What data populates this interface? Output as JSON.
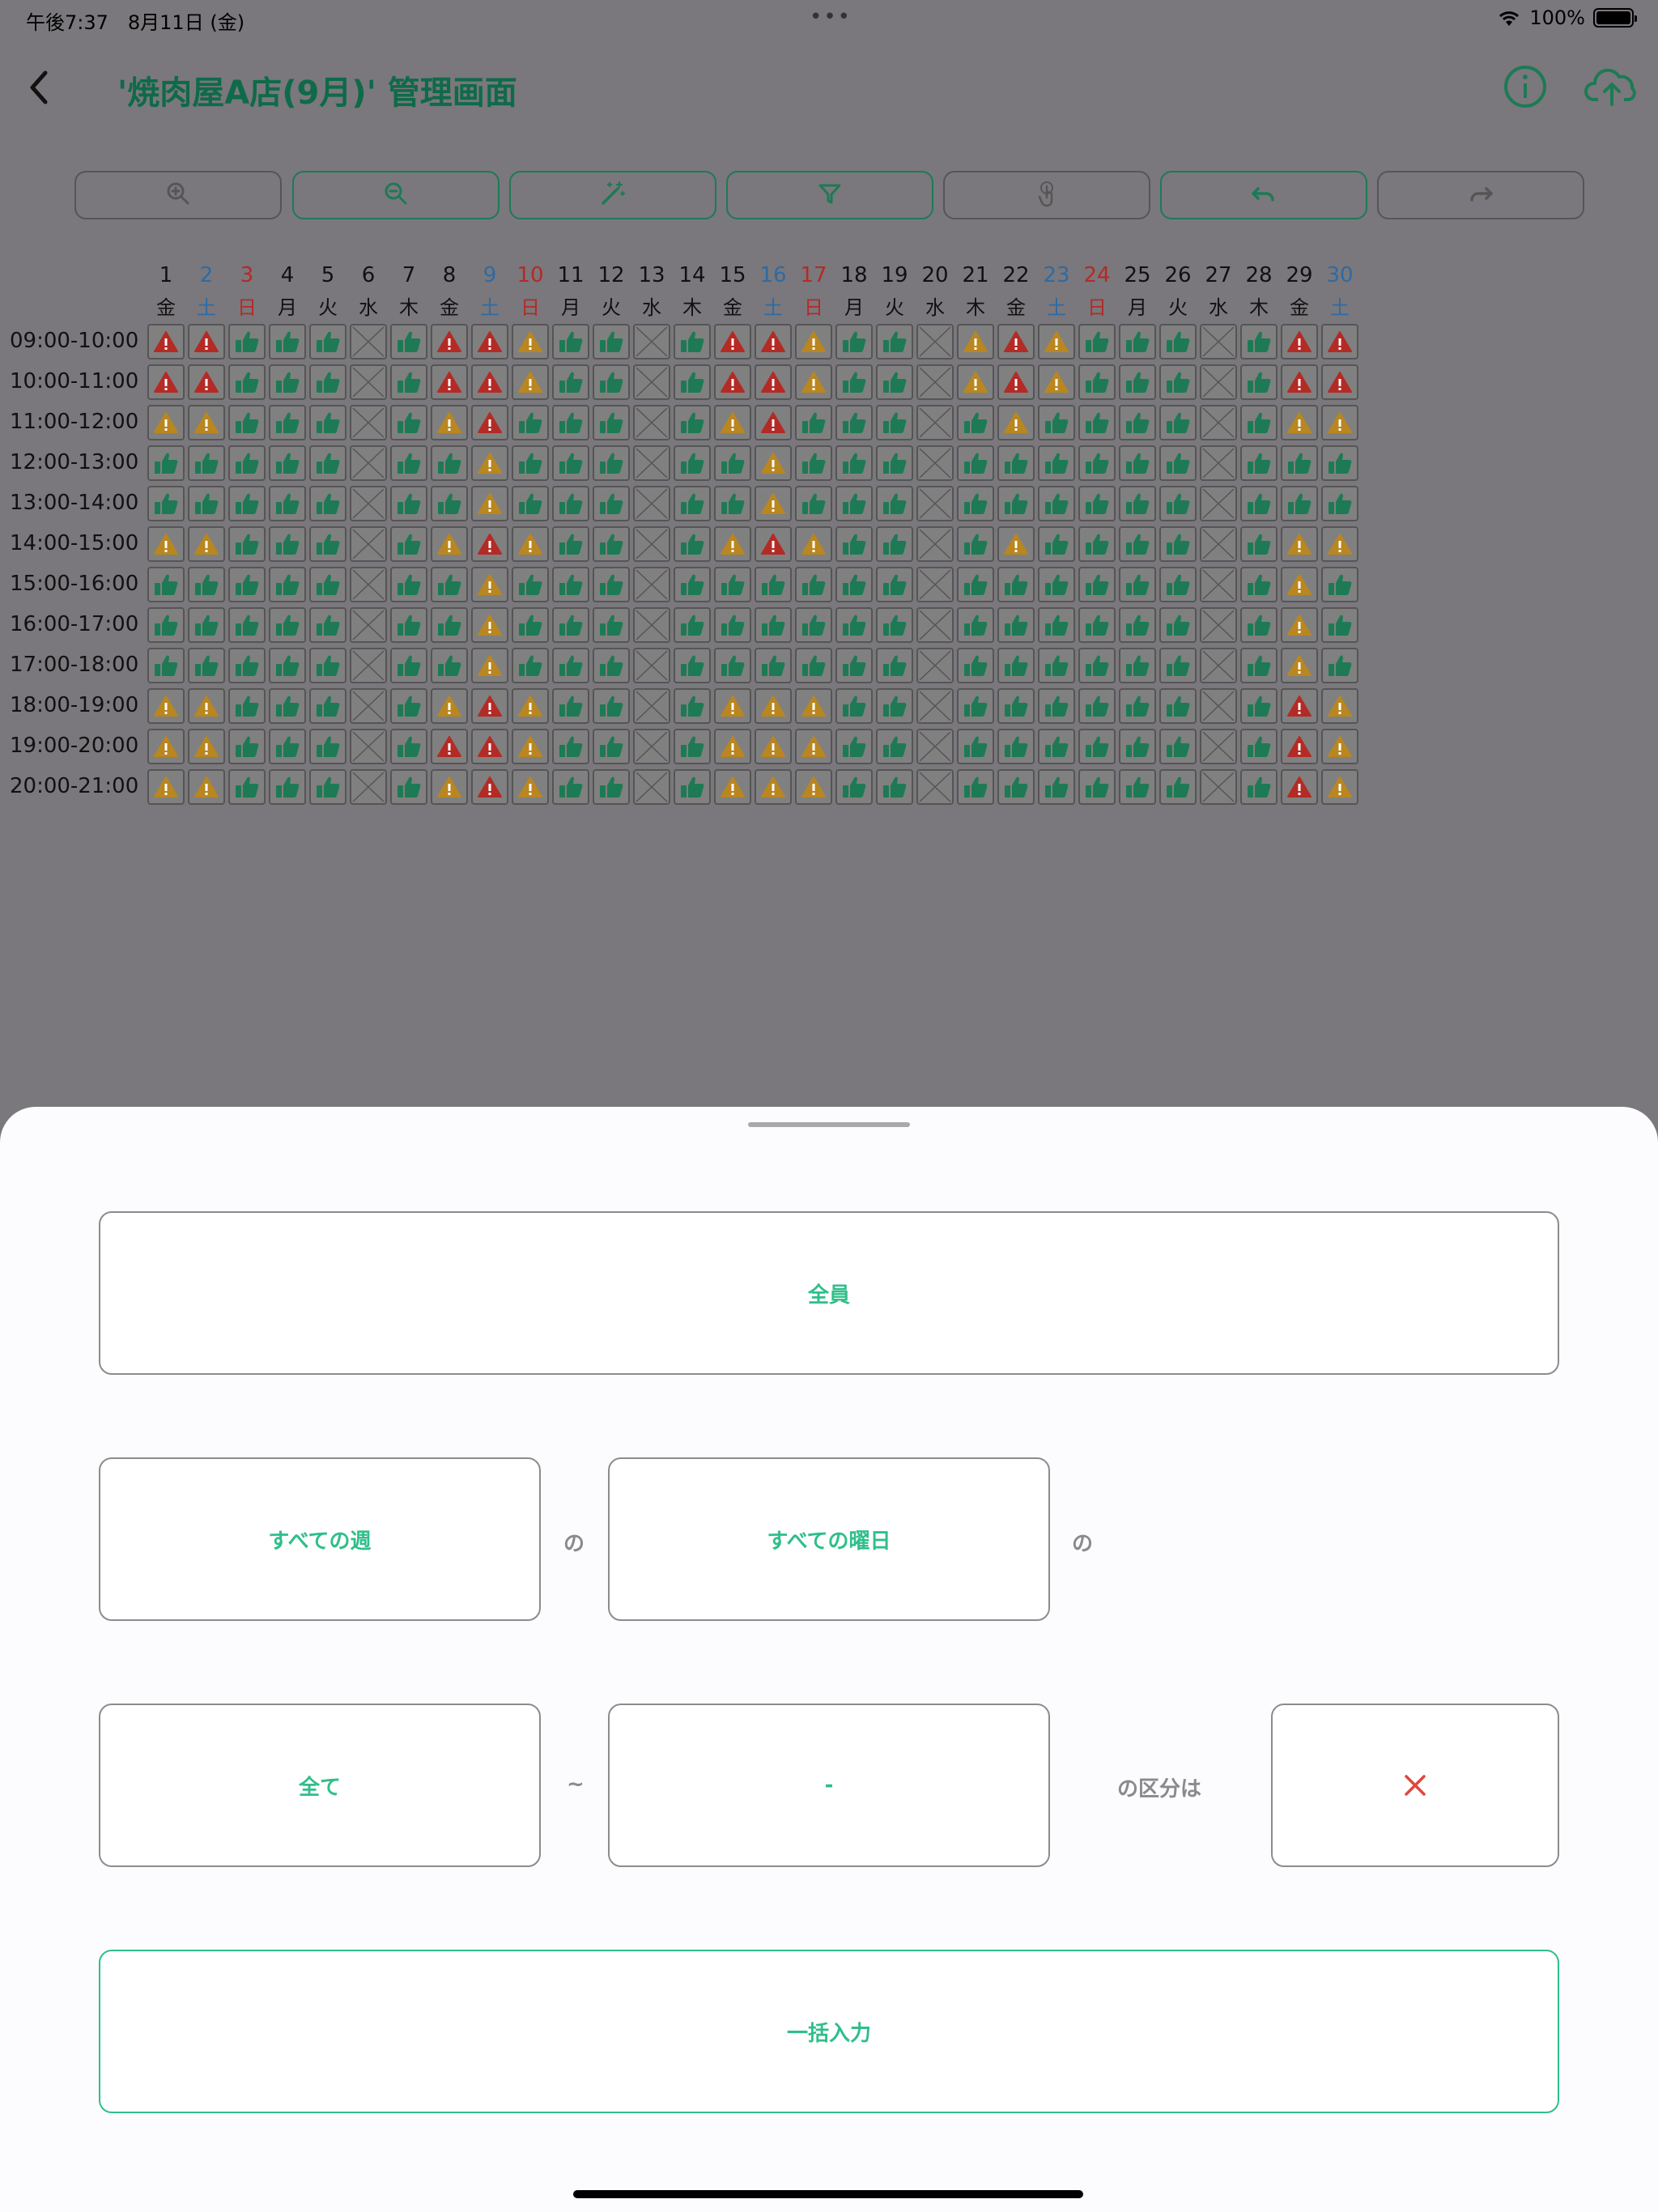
{
  "status_bar": {
    "time": "午後7:37　8月11日 (金)",
    "battery": "100%"
  },
  "nav": {
    "title": "'焼肉屋A店(9月)' 管理画面",
    "back_icon": "chevron-left-icon",
    "info_icon": "info-icon",
    "upload_icon": "cloud-upload-icon"
  },
  "toolbar": [
    {
      "icon": "zoom-in-icon",
      "active": false
    },
    {
      "icon": "zoom-out-icon",
      "active": true
    },
    {
      "icon": "magic-wand-icon",
      "active": true
    },
    {
      "icon": "filter-icon",
      "active": true
    },
    {
      "icon": "tap-icon",
      "active": false
    },
    {
      "icon": "undo-icon",
      "active": true
    },
    {
      "icon": "redo-icon",
      "active": false
    }
  ],
  "days": [
    {
      "d": "1",
      "w": "金",
      "c": "k"
    },
    {
      "d": "2",
      "w": "土",
      "c": "b"
    },
    {
      "d": "3",
      "w": "日",
      "c": "r"
    },
    {
      "d": "4",
      "w": "月",
      "c": "k"
    },
    {
      "d": "5",
      "w": "火",
      "c": "k"
    },
    {
      "d": "6",
      "w": "水",
      "c": "k"
    },
    {
      "d": "7",
      "w": "木",
      "c": "k"
    },
    {
      "d": "8",
      "w": "金",
      "c": "k"
    },
    {
      "d": "9",
      "w": "土",
      "c": "b"
    },
    {
      "d": "10",
      "w": "日",
      "c": "r"
    },
    {
      "d": "11",
      "w": "月",
      "c": "k"
    },
    {
      "d": "12",
      "w": "火",
      "c": "k"
    },
    {
      "d": "13",
      "w": "水",
      "c": "k"
    },
    {
      "d": "14",
      "w": "木",
      "c": "k"
    },
    {
      "d": "15",
      "w": "金",
      "c": "k"
    },
    {
      "d": "16",
      "w": "土",
      "c": "b"
    },
    {
      "d": "17",
      "w": "日",
      "c": "r"
    },
    {
      "d": "18",
      "w": "月",
      "c": "k"
    },
    {
      "d": "19",
      "w": "火",
      "c": "k"
    },
    {
      "d": "20",
      "w": "水",
      "c": "k"
    },
    {
      "d": "21",
      "w": "木",
      "c": "k"
    },
    {
      "d": "22",
      "w": "金",
      "c": "k"
    },
    {
      "d": "23",
      "w": "土",
      "c": "b"
    },
    {
      "d": "24",
      "w": "日",
      "c": "r"
    },
    {
      "d": "25",
      "w": "月",
      "c": "k"
    },
    {
      "d": "26",
      "w": "火",
      "c": "k"
    },
    {
      "d": "27",
      "w": "水",
      "c": "k"
    },
    {
      "d": "28",
      "w": "木",
      "c": "k"
    },
    {
      "d": "29",
      "w": "金",
      "c": "k"
    },
    {
      "d": "30",
      "w": "土",
      "c": "b"
    }
  ],
  "times": [
    "09:00-10:00",
    "10:00-11:00",
    "11:00-12:00",
    "12:00-13:00",
    "13:00-14:00",
    "14:00-15:00",
    "15:00-16:00",
    "16:00-17:00",
    "17:00-18:00",
    "18:00-19:00",
    "19:00-20:00",
    "20:00-21:00"
  ],
  "legend": {
    "G": "thumbs-up-icon",
    "R": "warning-red-icon",
    "Y": "warning-yellow-icon",
    "X": "cross-box-icon"
  },
  "grid_rows": [
    "RRGGGXGRRYGGXGRRYGGXYRYGGGXGRR",
    "RRGGGXGRRYGGXGRRYGGXYRYGGGXGRR",
    "YYGGGXGYRGGGXGYRGGGXGYGGGGXGYY",
    "GGGGGXGGYGGGXGGYGGGXGGGGGGXGGG",
    "GGGGGXGGYGGGXGGYGGGXGGGGGGXGGG",
    "YYGGGXGYRYGGXGYRYGGXGYGGGGXGYY",
    "GGGGGXGGYGGGXGGGGGGXGGGGGGXGYG",
    "GGGGGXGGYGGGXGGGGGGXGGGGGGXGYG",
    "GGGGGXGGYGGGXGGGGGGXGGGGGGXGYG",
    "YYGGGXGYRYGGXGYYYGGXGGGGGGXGRY",
    "YYGGGXGRRYGGXGYYYGGXGGGGGGXGRY",
    "YYGGGXGYRYGGXGYYYGGXGGGGGGXGRY"
  ],
  "colors": {
    "green": "#1d7a55",
    "red": "#b42a25",
    "yellow": "#b9861f",
    "blue": "#2f6aa3",
    "accent": "#2fbf8a"
  },
  "sheet": {
    "target": "全員",
    "week": "すべての週",
    "conn_no1": "の",
    "weekday": "すべての曜日",
    "conn_no2": "の",
    "from": "全て",
    "tilde": "~",
    "to": "-",
    "category_text": "の区分は",
    "category_icon": "close-icon",
    "submit": "一括入力"
  }
}
